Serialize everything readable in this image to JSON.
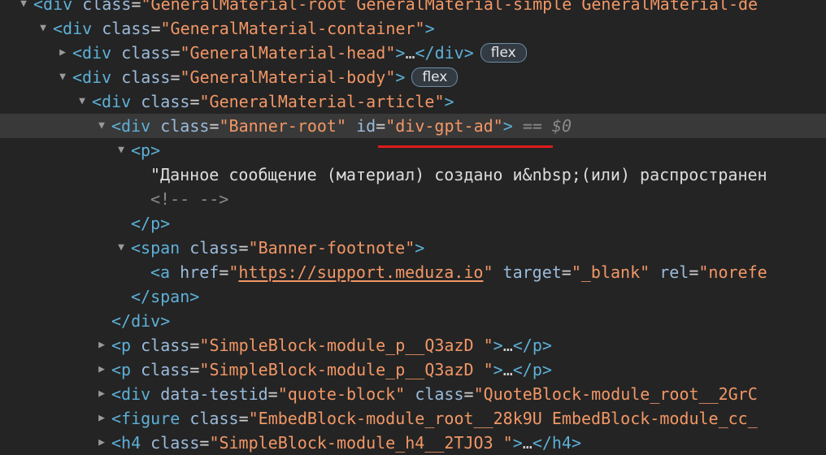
{
  "elements": {
    "root_div": {
      "tag": "div",
      "attr_class": "class",
      "eq": "=",
      "class_value": "\"GeneralMaterial-root GeneralMaterial-simple GeneralMaterial-de"
    },
    "container_div": {
      "open": "<div",
      "attr_class": "class",
      "eq": "=",
      "class_value": "\"GeneralMaterial-container\"",
      "close": ">"
    },
    "head_div": {
      "open": "<div",
      "attr_class": "class",
      "eq": "=",
      "class_value": "\"GeneralMaterial-head\"",
      "close": ">",
      "ellipsis": "…",
      "end": "</div>",
      "badge": "flex"
    },
    "body_div": {
      "open": "<div",
      "attr_class": "class",
      "eq": "=",
      "class_value": "\"GeneralMaterial-body\"",
      "close": ">",
      "badge": "flex"
    },
    "article_div": {
      "open": "<div",
      "attr_class": "class",
      "eq": "=",
      "class_value": "\"GeneralMaterial-article\"",
      "close": ">"
    },
    "banner_div": {
      "open": "<div",
      "attr_class": "class",
      "eq": "=",
      "class_value": "\"Banner-root\"",
      "attr_id": "id",
      "id_value": "\"div-gpt-ad\"",
      "close": ">",
      "selected_marker": "== $0"
    },
    "p_open": {
      "open": "<p",
      "close": ">"
    },
    "p_text": "\"Данное сообщение (материал) создано и&nbsp;(или) распространен",
    "comment": "<!-- -->",
    "p_close": "</p>",
    "span_footnote": {
      "open": "<span",
      "attr_class": "class",
      "eq": "=",
      "class_value": "\"Banner-footnote\"",
      "close": ">"
    },
    "anchor": {
      "open": "<a",
      "attr_href": "href",
      "eq": "=",
      "q": "\"",
      "href_value": "https://support.meduza.io",
      "attr_target": "target",
      "target_value": "\"_blank\"",
      "attr_rel": "rel",
      "rel_value": "\"norefe"
    },
    "span_close": "</span>",
    "div_close": "</div>",
    "p_block_1": {
      "open": "<p",
      "attr_class": "class",
      "eq": "=",
      "class_value": "\"SimpleBlock-module_p__Q3azD \"",
      "close": ">",
      "ellipsis": "…",
      "end": "</p>"
    },
    "p_block_2": {
      "open": "<p",
      "attr_class": "class",
      "eq": "=",
      "class_value": "\"SimpleBlock-module_p__Q3azD \"",
      "close": ">",
      "ellipsis": "…",
      "end": "</p>"
    },
    "quote_div": {
      "open": "<div",
      "attr_testid": "data-testid",
      "eq": "=",
      "testid_value": "\"quote-block\"",
      "attr_class": "class",
      "class_value": "\"QuoteBlock-module_root__2GrC"
    },
    "figure": {
      "open": "<figure",
      "attr_class": "class",
      "eq": "=",
      "class_value": "\"EmbedBlock-module_root__28k9U EmbedBlock-module_cc_"
    },
    "h4": {
      "open": "<h4",
      "attr_class": "class",
      "eq": "=",
      "class_value": "\"SimpleBlock-module_h4__2TJO3 \"",
      "close": ">",
      "ellipsis": "…",
      "end": "</h4>"
    }
  },
  "icons": {
    "expanded": "triangle-down-icon",
    "collapsed": "triangle-right-icon"
  },
  "colors": {
    "tag": "#5db0d7",
    "attribute": "#9bbbdc",
    "value": "#f29766",
    "selection_row": "#393939",
    "underline": "#e01b1b",
    "background": "#242424"
  }
}
